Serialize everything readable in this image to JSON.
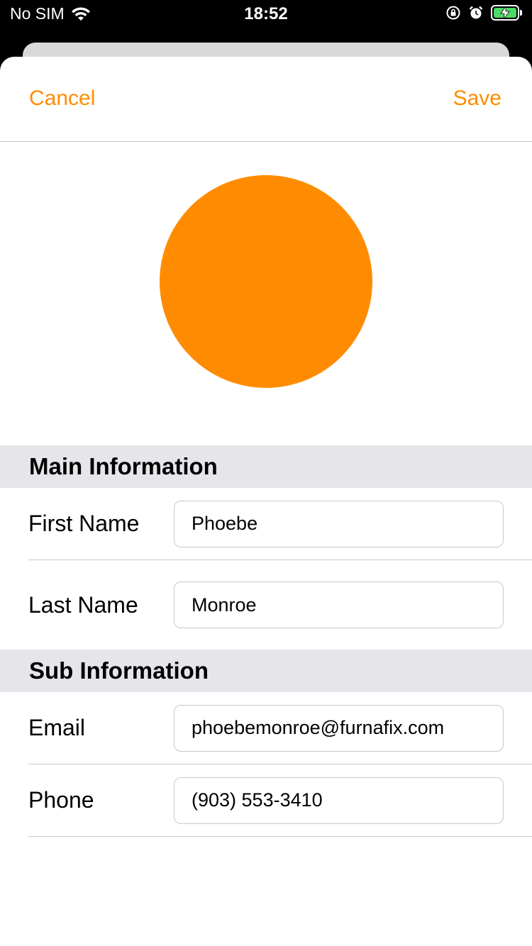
{
  "status_bar": {
    "carrier": "No SIM",
    "time": "18:52",
    "battery_color": "#4cd964"
  },
  "nav": {
    "cancel_label": "Cancel",
    "save_label": "Save",
    "accent_color": "#ff8c00"
  },
  "avatar": {
    "color": "#ff8c00"
  },
  "sections": {
    "main": {
      "title": "Main Information",
      "first_name_label": "First Name",
      "first_name_value": "Phoebe",
      "last_name_label": "Last Name",
      "last_name_value": "Monroe"
    },
    "sub": {
      "title": "Sub Information",
      "email_label": "Email",
      "email_value": "phoebemonroe@furnafix.com",
      "phone_label": "Phone",
      "phone_value": "(903) 553-3410"
    }
  }
}
